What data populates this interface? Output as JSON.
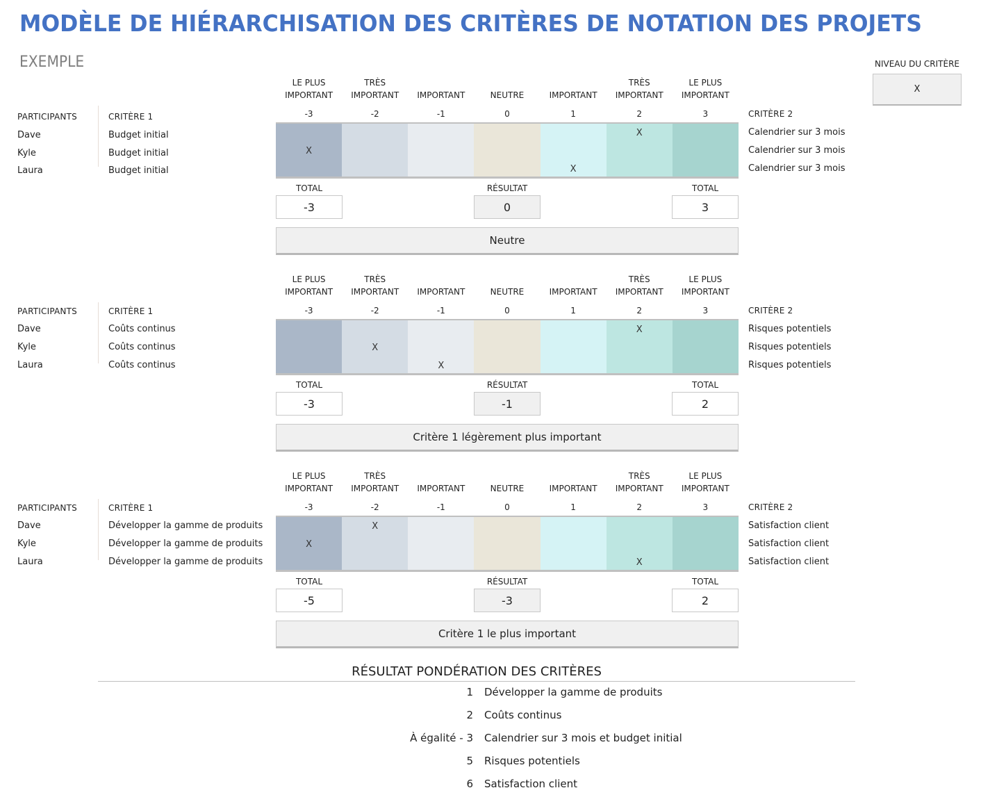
{
  "title": "MODÈLE DE HIÉRARCHISATION DES CRITÈRES DE NOTATION DES PROJETS",
  "subtitle": "EXEMPLE",
  "criterion_level": {
    "label": "NIVEAU DU CRITÈRE",
    "value": "X"
  },
  "scale": {
    "labels": [
      [
        "LE PLUS",
        "IMPORTANT"
      ],
      [
        "TRÈS",
        "IMPORTANT"
      ],
      [
        "",
        "IMPORTANT"
      ],
      [
        "",
        "NEUTRE"
      ],
      [
        "",
        "IMPORTANT"
      ],
      [
        "TRÈS",
        "IMPORTANT"
      ],
      [
        "LE PLUS",
        "IMPORTANT"
      ]
    ],
    "values": [
      "-3",
      "-2",
      "-1",
      "0",
      "1",
      "2",
      "3"
    ],
    "colors": [
      "#aab7c8",
      "#d4dce4",
      "#e8ecf0",
      "#eae6d9",
      "#d5f3f5",
      "#bde6e1",
      "#a6d4cf"
    ]
  },
  "labels": {
    "participants": "PARTICIPANTS",
    "criterion1": "CRITÈRE 1",
    "criterion2": "CRITÈRE 2",
    "total": "TOTAL",
    "result": "RÉSULTAT",
    "mark": "X"
  },
  "comparisons": [
    {
      "participants": [
        "Dave",
        "Kyle",
        "Laura"
      ],
      "criterion1": "Budget initial",
      "criterion2": "Calendrier sur 3 mois",
      "votes": [
        2,
        -3,
        1
      ],
      "total_left": "-3",
      "result": "0",
      "total_right": "3",
      "verdict": "Neutre"
    },
    {
      "participants": [
        "Dave",
        "Kyle",
        "Laura"
      ],
      "criterion1": "Coûts continus",
      "criterion2": "Risques potentiels",
      "votes": [
        2,
        -2,
        -1
      ],
      "total_left": "-3",
      "result": "-1",
      "total_right": "2",
      "verdict": "Critère 1 légèrement plus important"
    },
    {
      "participants": [
        "Dave",
        "Kyle",
        "Laura"
      ],
      "criterion1": "Développer la gamme de produits",
      "criterion2": "Satisfaction client",
      "votes": [
        -2,
        -3,
        2
      ],
      "total_left": "-5",
      "result": "-3",
      "total_right": "2",
      "verdict": "Critère 1 le plus important"
    }
  ],
  "summary": {
    "title": "RÉSULTAT PONDÉRATION DES CRITÈRES",
    "ranking": [
      {
        "rank": "1",
        "name": "Développer la gamme de produits"
      },
      {
        "rank": "2",
        "name": "Coûts continus"
      },
      {
        "rank": "À égalité - 3",
        "name": "Calendrier sur 3 mois et budget initial"
      },
      {
        "rank": "5",
        "name": "Risques potentiels"
      },
      {
        "rank": "6",
        "name": "Satisfaction client"
      }
    ]
  }
}
